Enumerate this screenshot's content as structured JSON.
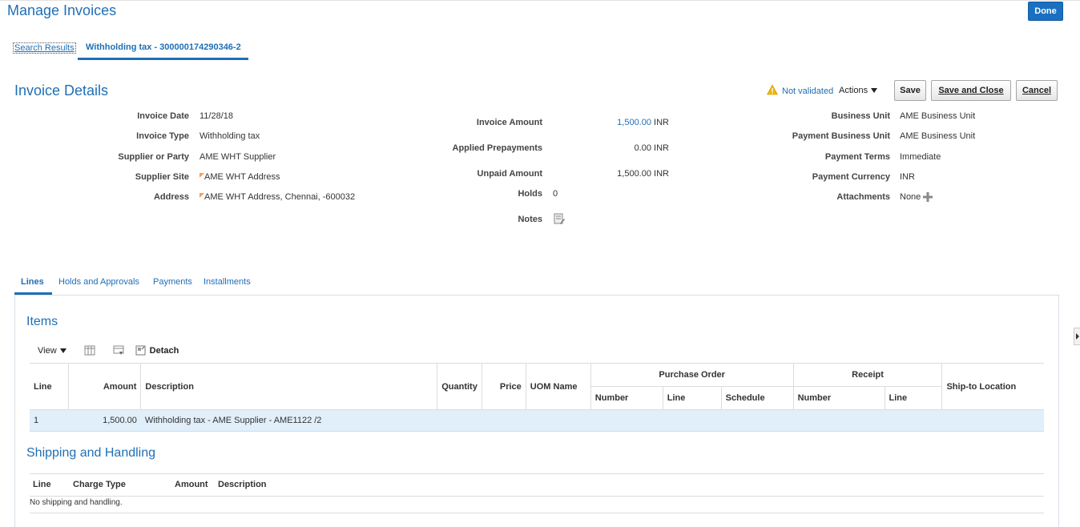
{
  "app": {
    "title": "Manage Invoices",
    "done_label": "Done"
  },
  "breadcrumbs": {
    "search_results": "Search Results",
    "current_tab": "Withholding tax - 300000174290346-2"
  },
  "section": {
    "title": "Invoice Details",
    "status": "Not validated",
    "actions_label": "Actions",
    "save_label": "Save",
    "save_close_label": "Save and Close",
    "cancel_label": "Cancel"
  },
  "left_fields": [
    {
      "label": "Invoice Date",
      "value": "11/28/18",
      "flag": false
    },
    {
      "label": "Invoice Type",
      "value": "Withholding tax",
      "flag": false
    },
    {
      "label": "Supplier or Party",
      "value": "AME WHT Supplier",
      "flag": false
    },
    {
      "label": "Supplier Site",
      "value": "AME WHT Address",
      "flag": true
    },
    {
      "label": "Address",
      "value": "AME WHT Address, Chennai, -600032",
      "flag": true
    }
  ],
  "middle_fields": {
    "invoice_amount": {
      "label": "Invoice Amount",
      "value": "1,500.00",
      "currency": "INR"
    },
    "applied_prepayments": {
      "label": "Applied Prepayments",
      "value": "0.00",
      "currency": "INR"
    },
    "unpaid_amount": {
      "label": "Unpaid Amount",
      "value": "1,500.00",
      "currency": "INR"
    },
    "holds": {
      "label": "Holds",
      "value": "0"
    },
    "notes": {
      "label": "Notes"
    }
  },
  "right_fields": [
    {
      "label": "Business Unit",
      "value": "AME Business Unit"
    },
    {
      "label": "Payment Business Unit",
      "value": "AME Business Unit"
    },
    {
      "label": "Payment Terms",
      "value": "Immediate"
    },
    {
      "label": "Payment Currency",
      "value": "INR"
    },
    {
      "label": "Attachments",
      "value": "None"
    }
  ],
  "tabs": [
    "Lines",
    "Holds and Approvals",
    "Payments",
    "Installments"
  ],
  "items": {
    "title": "Items",
    "toolbar": {
      "view_label": "View",
      "detach_label": "Detach"
    },
    "headers": {
      "line": "Line",
      "amount": "Amount",
      "description": "Description",
      "quantity": "Quantity",
      "price": "Price",
      "uom": "UOM Name",
      "purchase_order": "Purchase Order",
      "receipt": "Receipt",
      "ship_to": "Ship-to Location",
      "po_number": "Number",
      "po_line": "Line",
      "po_schedule": "Schedule",
      "rc_number": "Number",
      "rc_line": "Line"
    },
    "rows": [
      {
        "line": "1",
        "amount": "1,500.00",
        "description": "Withholding tax - AME Supplier - AME1122 /2"
      }
    ]
  },
  "shipping": {
    "title": "Shipping and Handling",
    "headers": {
      "line": "Line",
      "charge_type": "Charge Type",
      "amount": "Amount",
      "description": "Description"
    },
    "empty_text": "No shipping and handling."
  }
}
